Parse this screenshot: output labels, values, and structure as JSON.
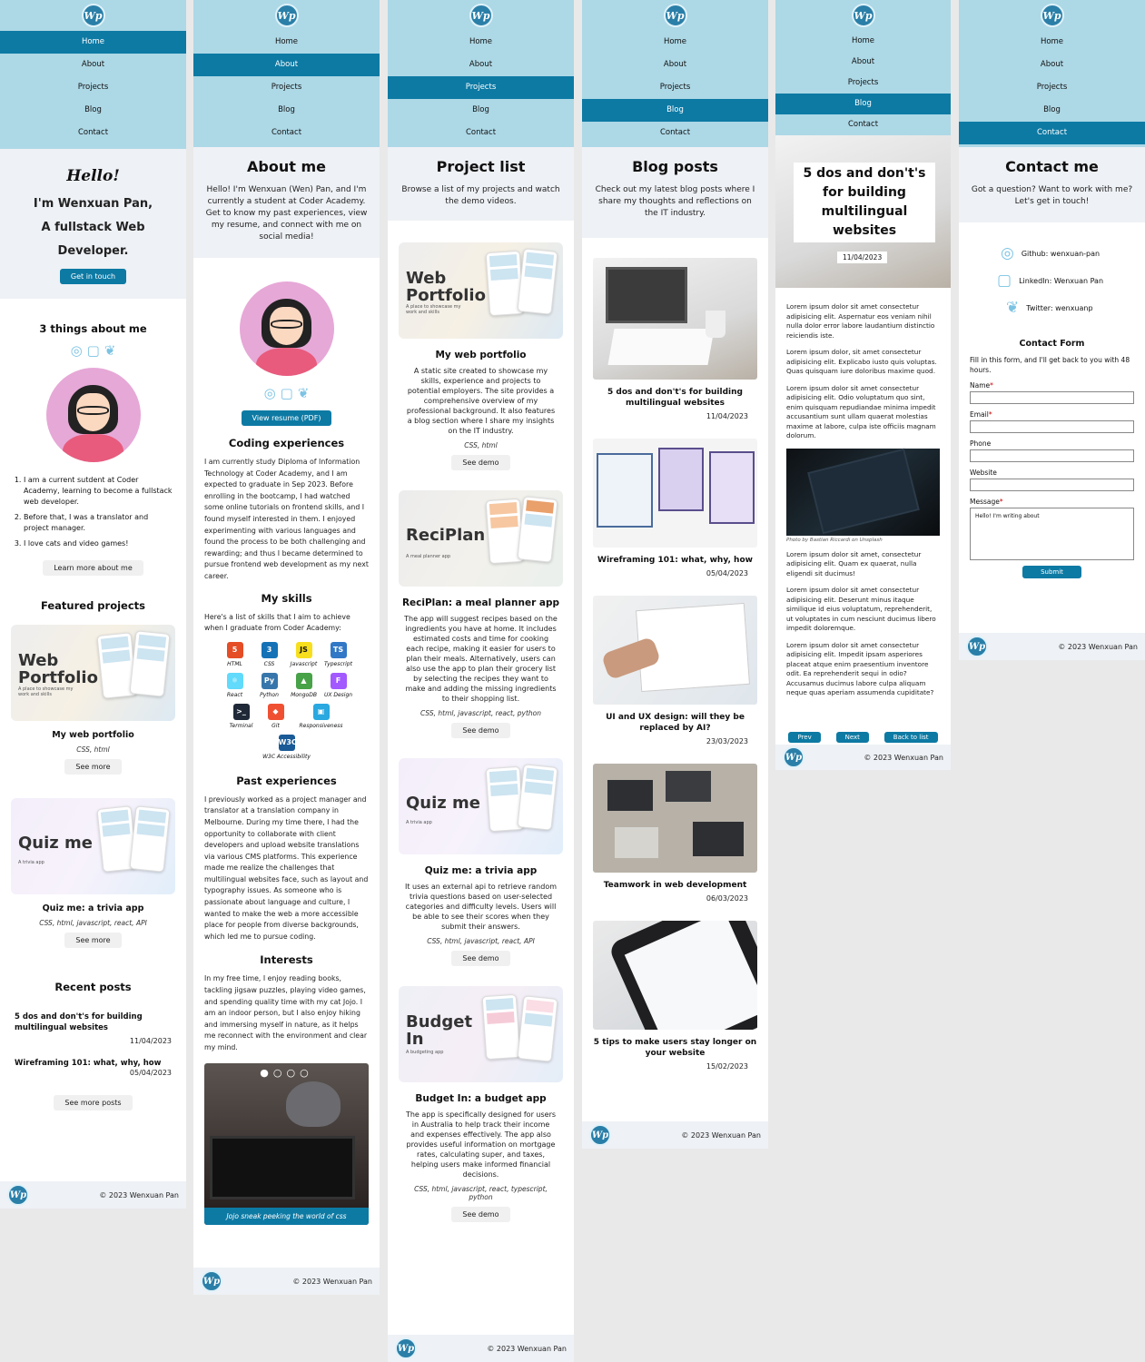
{
  "site": {
    "logo": "Wp",
    "footer_text": "© 2023 Wenxuan Pan"
  },
  "nav": {
    "items": [
      "Home",
      "About",
      "Projects",
      "Blog",
      "Contact"
    ]
  },
  "home": {
    "hello": "Hello!",
    "intro_name_line": "I'm Wenxuan Pan,",
    "intro_role_line1": "A fullstack Web",
    "intro_role_line2": "Developer.",
    "cta": "Get in touch",
    "things_title": "3 things about me",
    "things": [
      "I am a current sutdent at Coder Academy, learning to become a fullstack web developer.",
      "Before that, I was a translator and project manager.",
      "I love cats and video games!"
    ],
    "learn_more": "Learn more about me",
    "featured_title": "Featured projects",
    "projects": [
      {
        "title": "My web portfolio",
        "tech": "CSS, html",
        "button": "See more",
        "img_title": "Web Portfolio",
        "img_sub": "A place to showcase my work and skills"
      },
      {
        "title": "Quiz me: a trivia app",
        "tech": "CSS, html, javascript, react, API",
        "button": "See more",
        "img_title": "Quiz me",
        "img_sub": "A trivia app"
      }
    ],
    "recent_title": "Recent posts",
    "posts": [
      {
        "title": "5 dos and don't's for building multilingual websites",
        "date": "11/04/2023"
      },
      {
        "title": "Wireframing 101: what, why, how",
        "date": "05/04/2023"
      }
    ],
    "see_posts": "See more posts"
  },
  "about": {
    "title": "About me",
    "intro": "Hello! I'm Wenxuan (Wen) Pan, and I'm currently a student at Coder Academy. Get to know my past experiences, view my resume, and connect with me on social media!",
    "resume": "View resume (PDF)",
    "coding_title": "Coding experiences",
    "coding_text": "I am currently study Diploma of Information Technology at Coder Academy, and I am expected to graduate in Sep 2023. Before enrolling in the bootcamp, I had watched some online tutorials on frontend skills, and I found myself interested in them. I enjoyed experimenting with various languages and found the process to be both challenging and rewarding; and thus I became determined to pursue frontend web development as my next career.",
    "skills_title": "My skills",
    "skills_intro": "Here's a list of skills that I aim to achieve when I graduate from Coder Academy:",
    "skills": [
      {
        "name": "HTML",
        "icon": "5",
        "color": "#e44d26"
      },
      {
        "name": "CSS",
        "icon": "3",
        "color": "#1572b6"
      },
      {
        "name": "Javascript",
        "icon": "JS",
        "color": "#f7df1e"
      },
      {
        "name": "Typescript",
        "icon": "TS",
        "color": "#3178c6"
      },
      {
        "name": "React",
        "icon": "⚛",
        "color": "#61dafb"
      },
      {
        "name": "Python",
        "icon": "Py",
        "color": "#3776ab"
      },
      {
        "name": "MongoDB",
        "icon": "▲",
        "color": "#47a248"
      },
      {
        "name": "UX Design",
        "icon": "F",
        "color": "#a259ff"
      },
      {
        "name": "Terminal",
        "icon": ">_",
        "color": "#1f2937"
      },
      {
        "name": "Git",
        "icon": "◆",
        "color": "#f05032"
      },
      {
        "name": "Responsiveness",
        "icon": "▣",
        "color": "#2aa8e0"
      },
      {
        "name": "W3C Accessibility",
        "icon": "W3C",
        "color": "#1a5a96"
      }
    ],
    "past_title": "Past experiences",
    "past_text": "I previously worked as a project manager and translator at a translation company in Melbourne. During my time there, I had the opportunity to collaborate with client developers and upload website translations via various CMS platforms. This experience made me realize the challenges that multilingual websites face, such as layout and typography issues. As someone who is passionate about language and culture, I wanted to make the web a more accessible place for people from diverse backgrounds, which led me to pursue coding.",
    "interests_title": "Interests",
    "interests_text": "In my free time, I enjoy reading books, tackling jigsaw puzzles, playing video games, and spending quality time with my cat Jojo. I am an indoor person, but I also enjoy hiking and immersing myself in nature, as it helps me reconnect with the environment and clear my mind.",
    "carousel_caption": "Jojo sneak peeking the world of css"
  },
  "projects": {
    "title": "Project list",
    "intro": "Browse a list of my projects and watch the demo videos.",
    "button": "See demo",
    "items": [
      {
        "img_title": "Web Portfolio",
        "img_sub": "A place to showcase my work and skills",
        "title": "My web portfolio",
        "desc": "A static site created to showcase my skills, experience and projects to potential employers. The site provides a comprehensive overview of my professional background. It also features a blog section where I share my insights on the IT industry.",
        "tech": "CSS, html"
      },
      {
        "img_title": "ReciPlan",
        "img_sub": "A meal planner app",
        "title": "ReciPlan: a meal planner app",
        "desc": "The app will suggest recipes based on the ingredients you have at home. It includes estimated costs and time for cooking each recipe, making it easier for users to plan their meals. Alternatively, users can also use the app to plan their grocery list by selecting the recipes they want to make and adding the missing ingredients to their shopping list.",
        "tech": "CSS, html, javascript, react, python"
      },
      {
        "img_title": "Quiz me",
        "img_sub": "A trivia app",
        "title": "Quiz me: a trivia app",
        "desc": "It uses an external api to retrieve random trivia questions based on user-selected categories and difficulty levels. Users will be able to see their scores when they submit their answers.",
        "tech": "CSS, html, javascript, react, API"
      },
      {
        "img_title": "Budget In",
        "img_sub": "A budgeting app",
        "title": "Budget In: a budget app",
        "desc": "The app is specifically designed for users in Australia to help track their income and expenses effectively. The app also provides useful information on mortgage rates, calculating super, and taxes, helping users make informed financial decisions.",
        "tech": "CSS, html, javascript, react, typescript, python"
      }
    ]
  },
  "blog": {
    "title": "Blog posts",
    "intro": "Check out my latest blog posts where I share my thoughts and reflections on the IT industry.",
    "posts": [
      {
        "title": "5 dos and don't's for building multilingual websites",
        "date": "11/04/2023"
      },
      {
        "title": "Wireframing 101: what, why, how",
        "date": "05/04/2023"
      },
      {
        "title": "UI and UX design: will they be replaced by AI?",
        "date": "23/03/2023"
      },
      {
        "title": "Teamwork in web development",
        "date": "06/03/2023"
      },
      {
        "title": "5 tips to make users stay longer on your website",
        "date": "15/02/2023"
      }
    ]
  },
  "post": {
    "title": "5 dos and don't's for building multilingual websites",
    "date": "11/04/2023",
    "paras": [
      "Lorem ipsum dolor sit amet consectetur adipisicing elit. Aspernatur eos veniam nihil nulla dolor error labore laudantium distinctio reiciendis iste.",
      "Lorem ipsum dolor, sit amet consectetur adipisicing elit. Explicabo iusto quis voluptas. Quas quisquam iure doloribus maxime quod.",
      "Lorem ipsum dolor sit amet consectetur adipisicing elit. Odio voluptatum quo sint, enim quisquam repudiandae minima impedit accusantium sunt ullam quaerat molestias maxime at labore, culpa iste officiis magnam dolorum."
    ],
    "photo_credit": "Photo by Bastian Riccardi on Unsplash",
    "paras2": [
      "Lorem ipsum dolor sit amet, consectetur adipisicing elit. Quam ex quaerat, nulla eligendi sit ducimus!",
      "Lorem ipsum dolor sit amet consectetur adipisicing elit. Deserunt minus itaque similique id eius voluptatum, reprehenderit, ut voluptates in cum nesciunt ducimus libero impedit doloremque.",
      "Lorem ipsum dolor sit amet consectetur adipisicing elit. Impedit ipsam asperiores placeat atque enim praesentium inventore odit. Ea reprehenderit sequi in odio? Accusamus ducimus labore culpa aliquam neque quas aperiam assumenda cupiditate?"
    ],
    "prev": "Prev",
    "next": "Next",
    "back": "Back to list"
  },
  "contact": {
    "title": "Contact me",
    "intro": "Got a question? Want to work with me? Let's get in touch!",
    "links": [
      "Github: wenxuan-pan",
      "LinkedIn: Wenxuan Pan",
      "Twitter: wenxuanp"
    ],
    "form_title": "Contact Form",
    "form_intro": "Fill in this form, and I'll get back to you with 48 hours.",
    "labels": [
      "Name",
      "Email",
      "Phone",
      "Website",
      "Message"
    ],
    "message_value": "Hello! I'm writing about",
    "submit": "Submit"
  }
}
